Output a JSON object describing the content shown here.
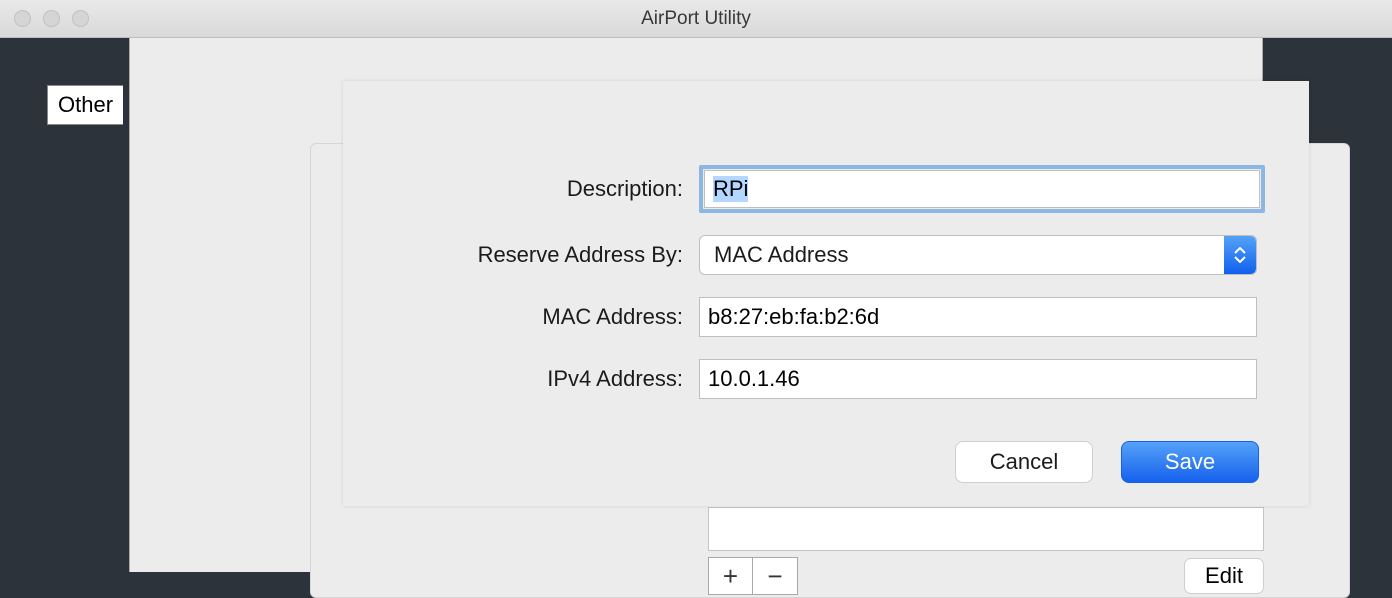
{
  "window": {
    "title": "AirPort Utility",
    "other_tab": "Other"
  },
  "form": {
    "description": {
      "label": "Description:",
      "value": "RPi"
    },
    "reserve_by": {
      "label": "Reserve Address By:",
      "value": "MAC Address"
    },
    "mac_address": {
      "label": "MAC Address:",
      "value": "b8:27:eb:fa:b2:6d"
    },
    "ipv4_address": {
      "label": "IPv4 Address:",
      "value": "10.0.1.46"
    }
  },
  "buttons": {
    "cancel": "Cancel",
    "save": "Save",
    "edit": "Edit",
    "plus": "+",
    "minus": "−"
  }
}
